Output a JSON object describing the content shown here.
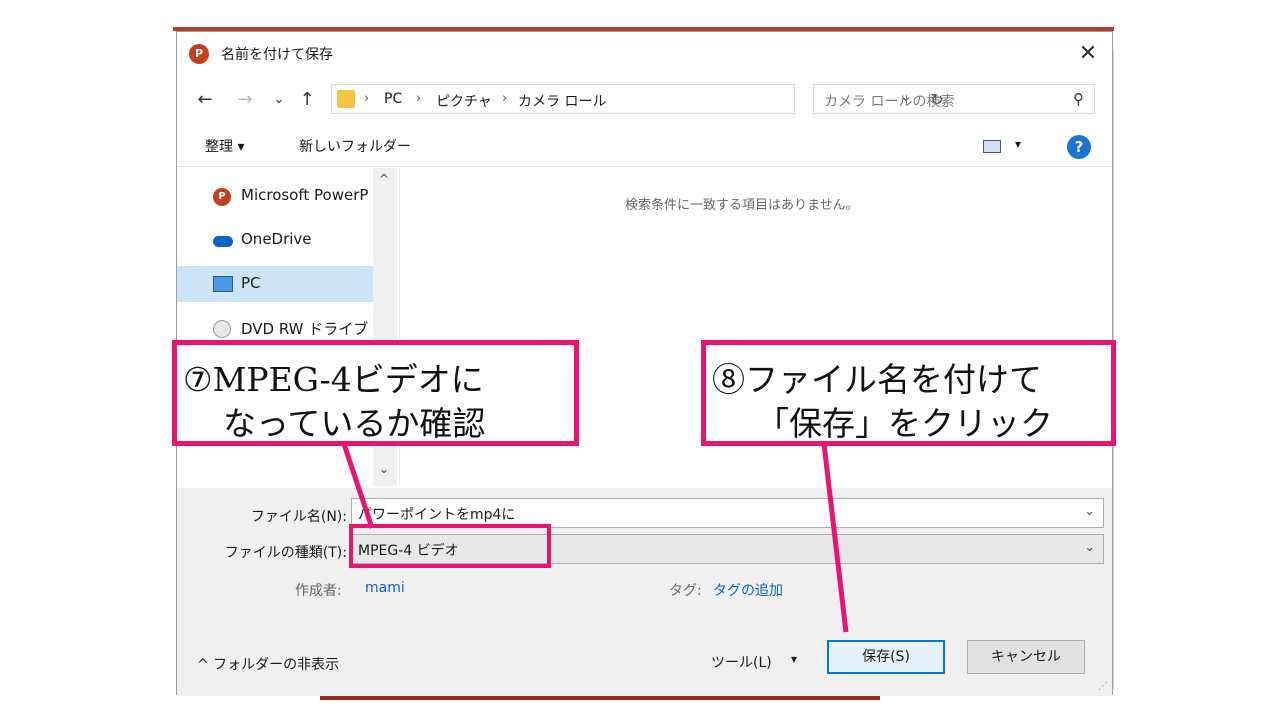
{
  "dialog": {
    "title": "名前を付けて保存",
    "app_icon_text": "P",
    "close_glyph": "✕"
  },
  "nav": {
    "back": "←",
    "forward": "→",
    "recent": "⌄",
    "up": "↑",
    "breadcrumb": [
      "PC",
      "ピクチャ",
      "カメラ ロール"
    ],
    "separator": "›",
    "dropdown": "⌄",
    "refresh": "↻",
    "search_placeholder": "カメラ ロールの検索",
    "search_icon": "⚲"
  },
  "toolbar": {
    "organize": "整理 ▾",
    "new_folder": "新しいフォルダー",
    "view_dropdown": "▾",
    "help": "?"
  },
  "sidebar": {
    "items": [
      {
        "label": "Microsoft PowerP",
        "icon": "powerpoint-icon",
        "icon_text": "P"
      },
      {
        "label": "OneDrive",
        "icon": "onedrive-icon"
      },
      {
        "label": "PC",
        "icon": "pc-icon",
        "selected": true
      },
      {
        "label": "DVD RW ドライブ (F",
        "icon": "dvd-icon"
      }
    ],
    "scroll_up": "^",
    "scroll_down": "⌄"
  },
  "content": {
    "empty_message": "検索条件に一致する項目はありません。"
  },
  "form": {
    "filename_label": "ファイル名(N):",
    "filename_value": "パワーポイントをmp4に",
    "filetype_label": "ファイルの種類(T):",
    "filetype_value": "MPEG-4 ビデオ",
    "dropdown": "⌄",
    "author_label": "作成者:",
    "author_value": "mami",
    "tags_label": "タグ:",
    "tags_value": "タグの追加"
  },
  "footer": {
    "hide_folders": "^  フォルダーの非表示",
    "tools": "ツール(L)",
    "tools_dd": "▾",
    "save": "保存(S)",
    "cancel": "キャンセル"
  },
  "annotations": {
    "step7_line1": "⑦MPEG-4ビデオに",
    "step7_line2": "なっているか確認",
    "step8_line1": "⑧ファイル名を付けて",
    "step8_line2": "「保存」をクリック"
  },
  "colors": {
    "annotation": "#e8146f",
    "accent": "#0078d7",
    "link": "#0b63c5"
  }
}
